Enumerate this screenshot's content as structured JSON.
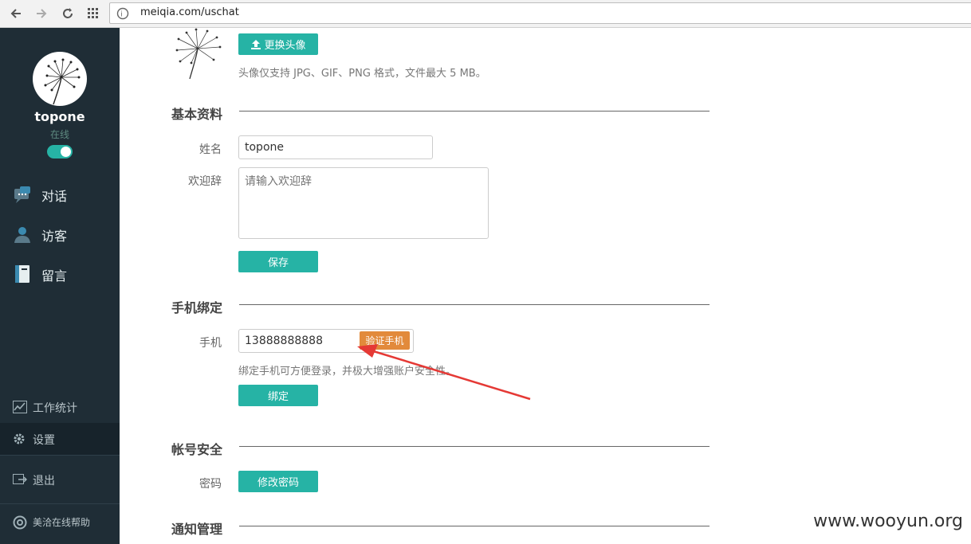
{
  "browser": {
    "url": "meiqia.com/uschat"
  },
  "sidebar": {
    "user_name": "topone",
    "user_status": "在线",
    "online_toggle": true,
    "nav": [
      {
        "label": "对话",
        "icon": "chat-icon"
      },
      {
        "label": "访客",
        "icon": "visitor-icon"
      },
      {
        "label": "留言",
        "icon": "message-book-icon"
      }
    ],
    "bottom": [
      {
        "label": "工作统计",
        "icon": "chart-icon"
      },
      {
        "label": "设置",
        "icon": "gear-icon",
        "active": true
      },
      {
        "label": "退出",
        "icon": "logout-icon"
      },
      {
        "label": "美洽在线帮助",
        "icon": "help-icon"
      }
    ]
  },
  "avatar_section": {
    "change_button": "更换头像",
    "hint": "头像仅支持 JPG、GIF、PNG 格式，文件最大 5 MB。"
  },
  "basic_info": {
    "title": "基本资料",
    "name_label": "姓名",
    "name_value": "topone",
    "welcome_label": "欢迎辞",
    "welcome_placeholder": "请输入欢迎辞",
    "save_button": "保存"
  },
  "phone_binding": {
    "title": "手机绑定",
    "phone_label": "手机",
    "phone_value": "13888888888",
    "verify_button": "验证手机",
    "hint": "绑定手机可方便登录，并极大增强账户安全性。",
    "bind_button": "绑定"
  },
  "account_security": {
    "title": "帐号安全",
    "password_label": "密码",
    "change_password_button": "修改密码"
  },
  "notification": {
    "title": "通知管理"
  },
  "watermark": "www.wooyun.org",
  "colors": {
    "accent": "#26b3a5",
    "sidebar": "#1f2d36",
    "verify": "#e28a3b",
    "arrow": "#e53935"
  }
}
